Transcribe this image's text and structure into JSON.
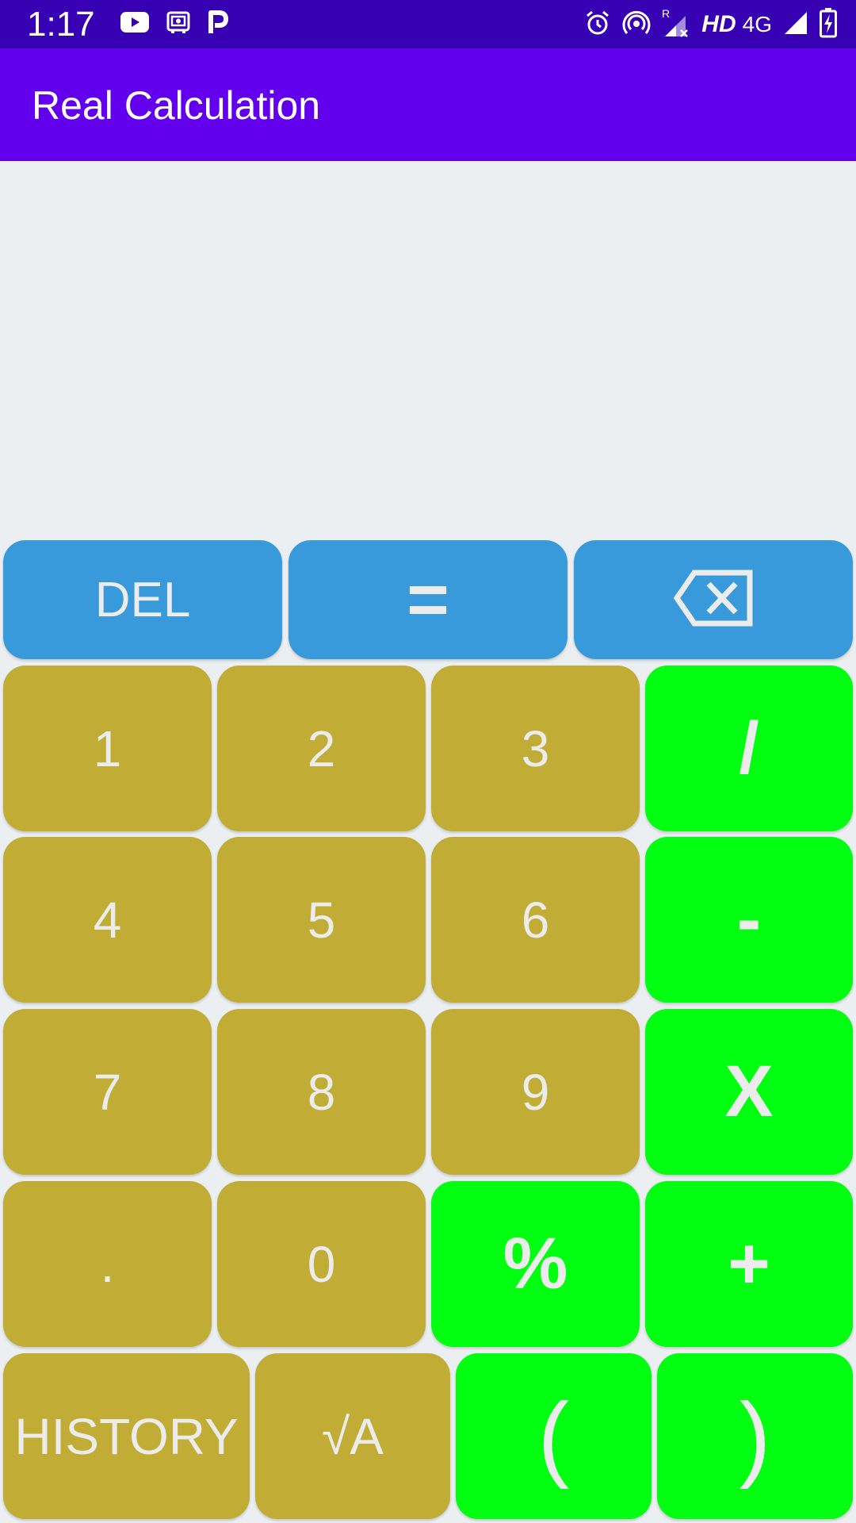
{
  "status_bar": {
    "time": "1:17",
    "left_icons": [
      "youtube-icon",
      "radio-icon",
      "p-app-icon"
    ],
    "right_icons": [
      "alarm-icon",
      "hotspot-icon",
      "signal-roaming-icon",
      "signal-icon",
      "battery-charging-icon"
    ],
    "network_hd": "HD",
    "network_type": "4G"
  },
  "app_bar": {
    "title": "Real Calculation"
  },
  "colors": {
    "status_bar": "#3700B3",
    "app_bar": "#6200EE",
    "background": "#ECEFF1",
    "key_blue": "#3899DB",
    "key_olive": "#C1AC35",
    "key_green": "#00FF10",
    "key_text": "#ECECEC"
  },
  "keypad": {
    "del": "DEL",
    "equals": "=",
    "backspace_icon": "backspace-icon",
    "k1": "1",
    "k2": "2",
    "k3": "3",
    "divide": "/",
    "k4": "4",
    "k5": "5",
    "k6": "6",
    "minus": "-",
    "k7": "7",
    "k8": "8",
    "k9": "9",
    "multiply": "X",
    "dot": ".",
    "k0": "0",
    "percent": "%",
    "plus": "+",
    "history": "HISTORY",
    "sqrt": "√A",
    "open_paren": "(",
    "close_paren": ")"
  }
}
